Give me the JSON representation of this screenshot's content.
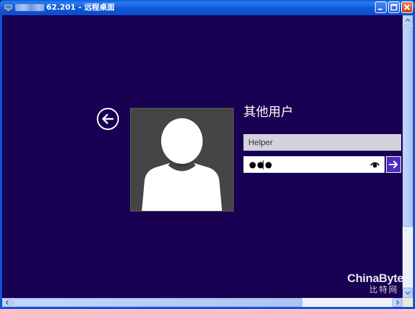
{
  "window": {
    "title_ip_suffix": "62.201",
    "title_separator": "-",
    "title_app": "远程桌面"
  },
  "login": {
    "heading": "其他用户",
    "username_value": "Helper",
    "password_mask": "●●●"
  },
  "watermark": {
    "brand": "ChinaByte",
    "brand_cn": "比特网"
  },
  "icons": {
    "back": "back-arrow-icon",
    "avatar": "user-silhouette-icon",
    "reveal": "eye-icon",
    "submit": "arrow-right-icon"
  },
  "colors": {
    "background": "#180052",
    "submit_accent": "#4c2dbf",
    "title_bar": "#0a5fdd"
  }
}
